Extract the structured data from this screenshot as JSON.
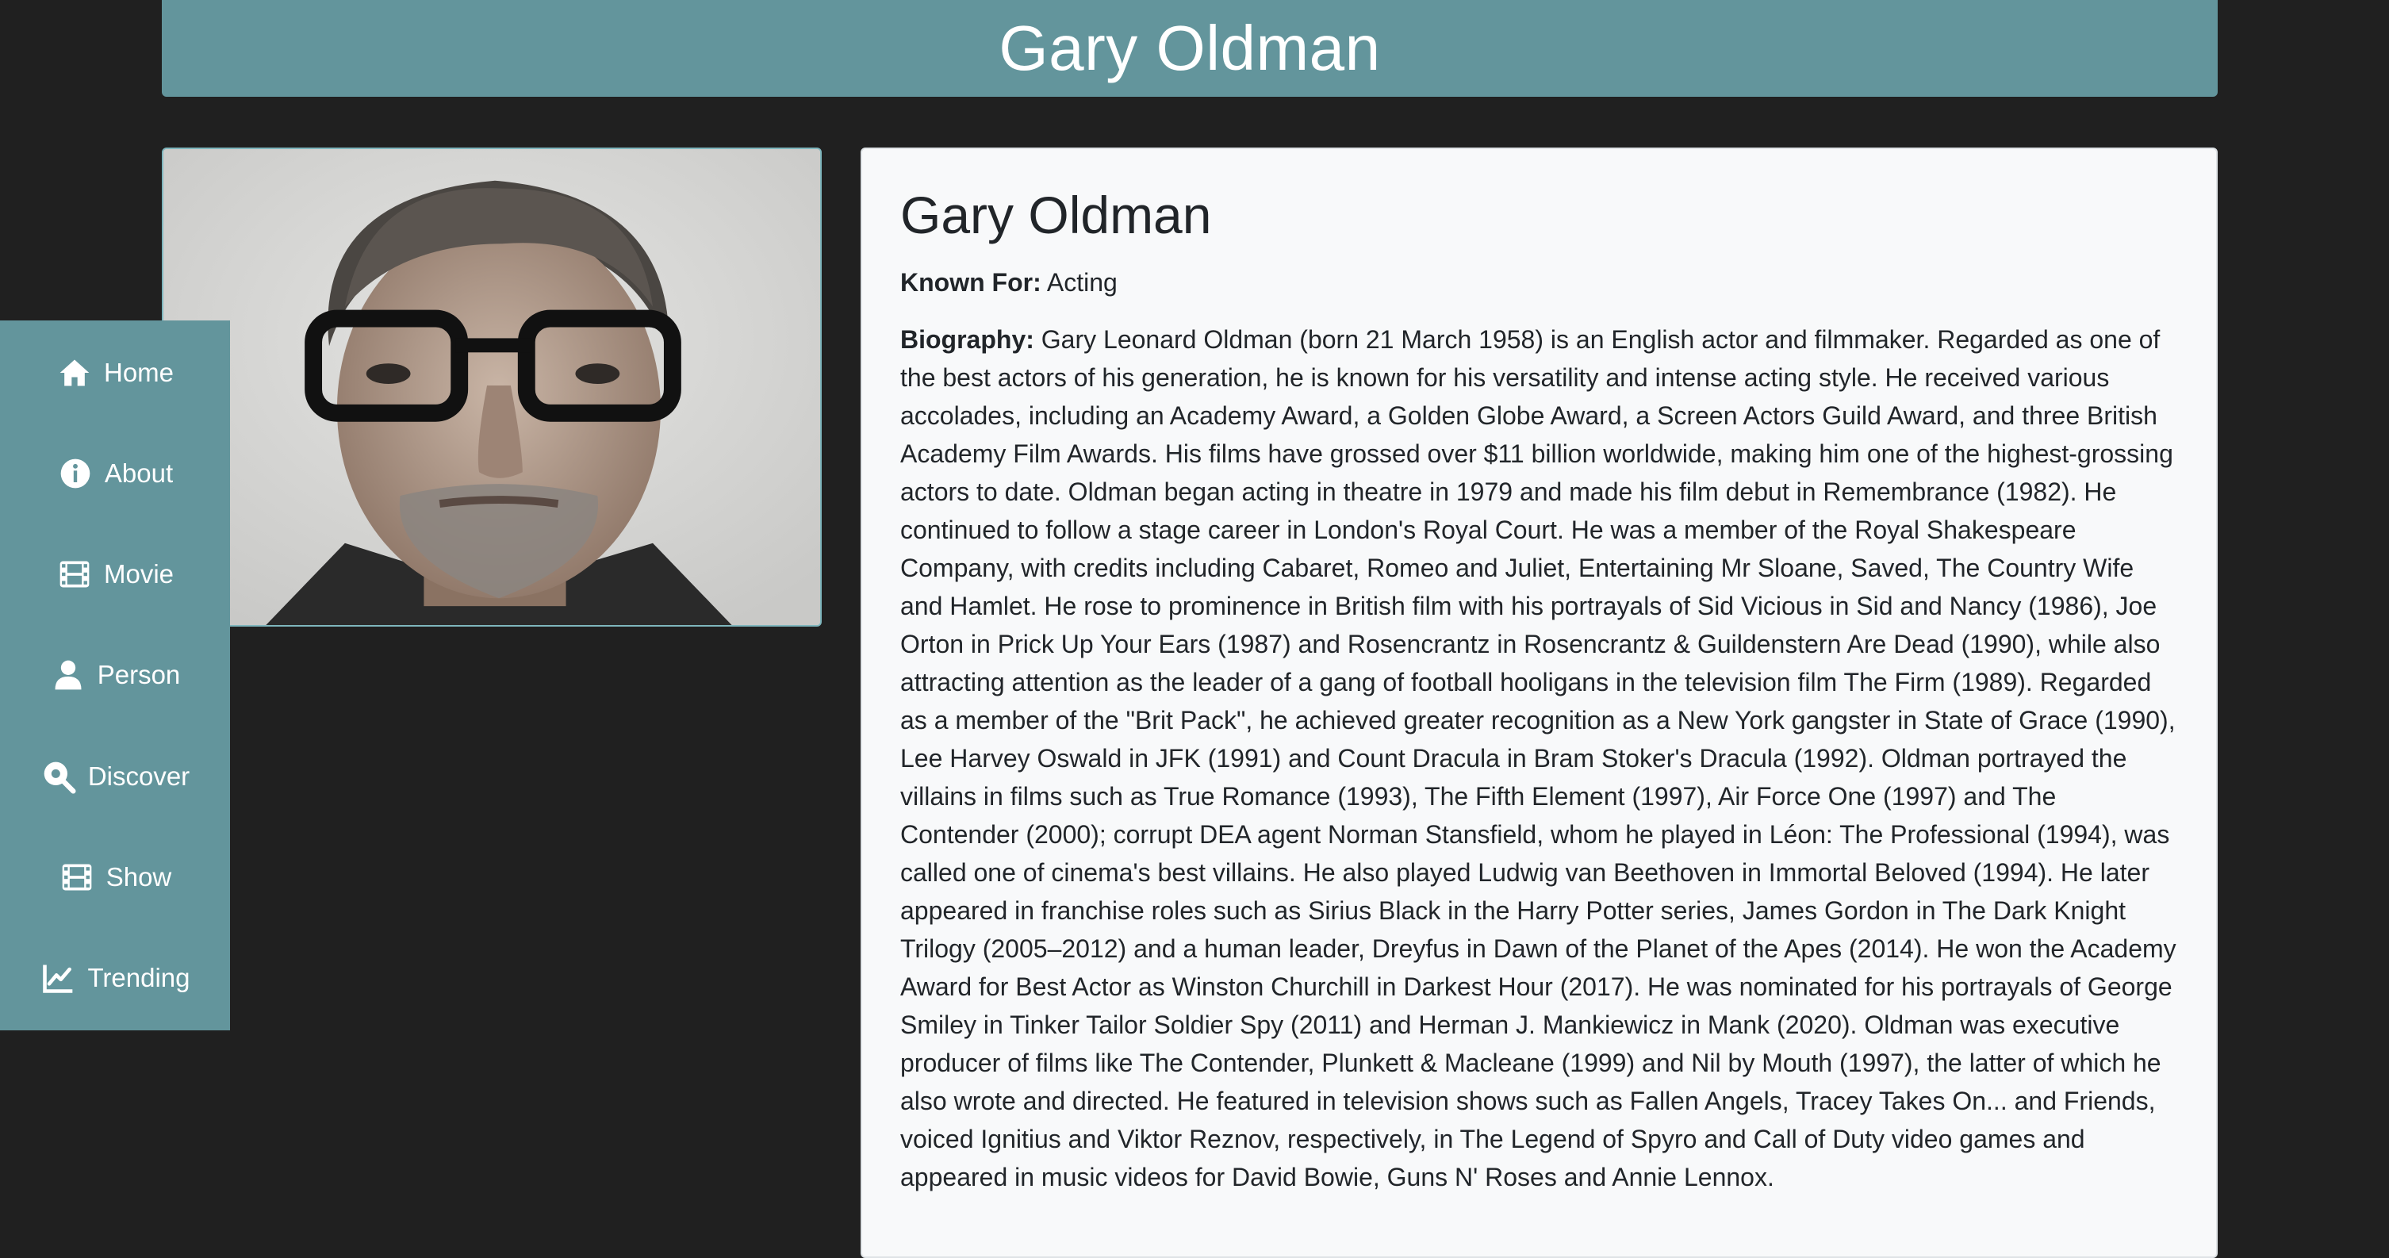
{
  "colors": {
    "accent": "#63959c",
    "background": "#202020",
    "card": "#f8f9fa"
  },
  "header": {
    "title": "Gary Oldman"
  },
  "sidebar": {
    "items": [
      {
        "label": "Home",
        "icon": "home-icon"
      },
      {
        "label": "About",
        "icon": "info-icon"
      },
      {
        "label": "Movie",
        "icon": "film-icon"
      },
      {
        "label": "Person",
        "icon": "person-icon"
      },
      {
        "label": "Discover",
        "icon": "search-icon"
      },
      {
        "label": "Show",
        "icon": "film-icon"
      },
      {
        "label": "Trending",
        "icon": "chart-line-icon"
      }
    ]
  },
  "person": {
    "name": "Gary Oldman",
    "known_for_label": "Known For:",
    "known_for": "Acting",
    "biography_label": "Biography:",
    "biography": "Gary Leonard Oldman (born 21 March 1958) is an English actor and filmmaker. Regarded as one of the best actors of his generation, he is known for his versatility and intense acting style. He received various accolades, including an Academy Award, a Golden Globe Award, a Screen Actors Guild Award, and three British Academy Film Awards. His films have grossed over $11 billion worldwide, making him one of the highest-grossing actors to date. Oldman began acting in theatre in 1979 and made his film debut in Remembrance (1982). He continued to follow a stage career in London's Royal Court. He was a member of the Royal Shakespeare Company, with credits including Cabaret, Romeo and Juliet, Entertaining Mr Sloane, Saved, The Country Wife and Hamlet. He rose to prominence in British film with his portrayals of Sid Vicious in Sid and Nancy (1986), Joe Orton in Prick Up Your Ears (1987) and Rosencrantz in Rosencrantz & Guildenstern Are Dead (1990), while also attracting attention as the leader of a gang of football hooligans in the television film The Firm (1989). Regarded as a member of the \"Brit Pack\", he achieved greater recognition as a New York gangster in State of Grace (1990), Lee Harvey Oswald in JFK (1991) and Count Dracula in Bram Stoker's Dracula (1992). Oldman portrayed the villains in films such as True Romance (1993), The Fifth Element (1997), Air Force One (1997) and The Contender (2000); corrupt DEA agent Norman Stansfield, whom he played in Léon: The Professional (1994), was called one of cinema's best villains. He also played Ludwig van Beethoven in Immortal Beloved (1994). He later appeared in franchise roles such as Sirius Black in the Harry Potter series, James Gordon in The Dark Knight Trilogy (2005–2012) and a human leader, Dreyfus in Dawn of the Planet of the Apes (2014). He won the Academy Award for Best Actor as Winston Churchill in Darkest Hour (2017). He was nominated for his portrayals of George Smiley in Tinker Tailor Soldier Spy (2011) and Herman J. Mankiewicz in Mank (2020). Oldman was executive producer of films like The Contender, Plunkett & Macleane (1999) and Nil by Mouth (1997), the latter of which he also wrote and directed. He featured in television shows such as Fallen Angels, Tracey Takes On... and Friends, voiced Ignitius and Viktor Reznov, respectively, in The Legend of Spyro and Call of Duty video games and appeared in music videos for David Bowie, Guns N' Roses and Annie Lennox."
  }
}
